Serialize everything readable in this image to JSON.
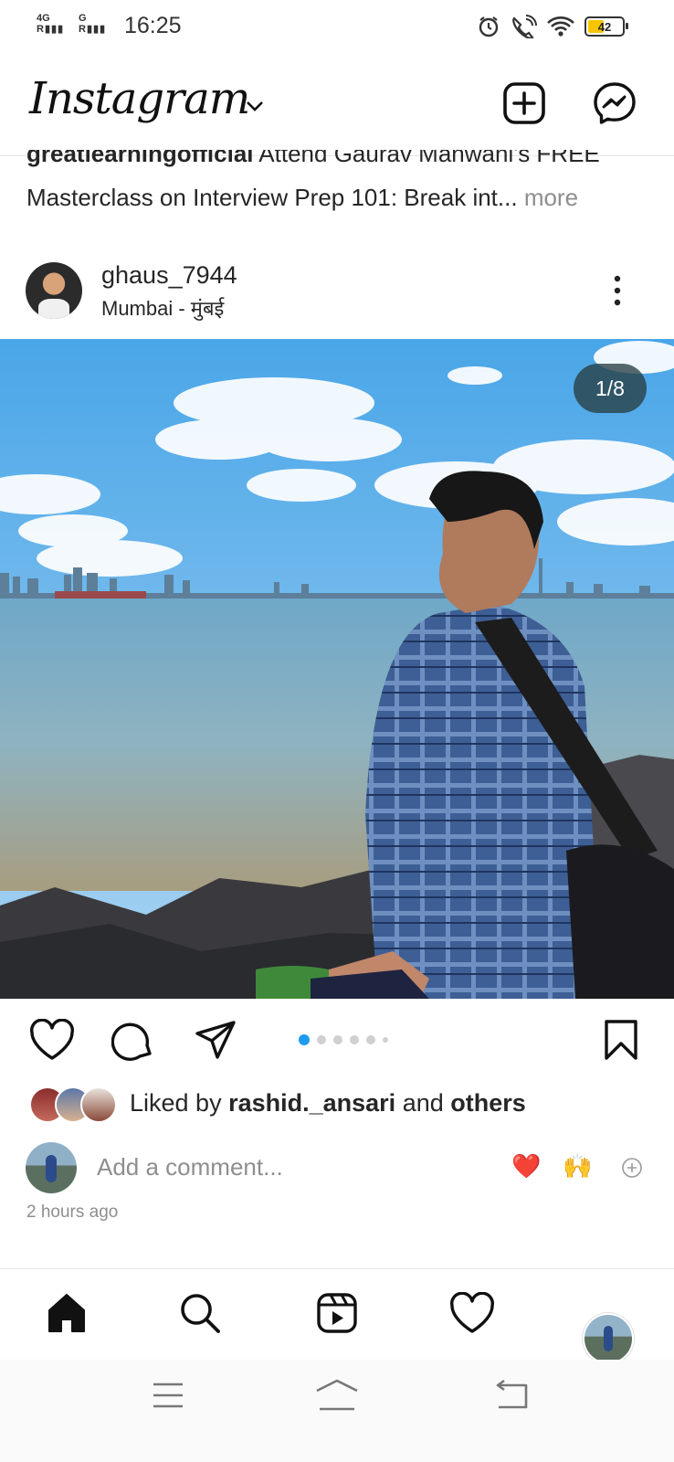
{
  "status_bar": {
    "network1": "4G",
    "network2": "G",
    "time": "16:25",
    "battery": "42",
    "icons": [
      "alarm-icon",
      "wifi-calling-icon",
      "wifi-icon",
      "battery-icon"
    ]
  },
  "header": {
    "logo": "Instagram",
    "icons": [
      "chevron-down-icon",
      "new-post-icon",
      "messenger-icon"
    ]
  },
  "caption": {
    "username": "greatlearningofficial",
    "text_line1": "Attend Gaurav Manwani's FREE",
    "text_line2": "Masterclass on Interview Prep 101: Break int...",
    "more": "more"
  },
  "post": {
    "username": "ghaus_7944",
    "location": "Mumbai - मुंबई",
    "image_counter": "1/8",
    "carousel": {
      "total_dots": 6,
      "active_index": 0
    },
    "likes": {
      "prefix": "Liked by",
      "user": "rashid._ansari",
      "conjunction": "and",
      "others": "others"
    },
    "comment_placeholder": "Add a comment...",
    "quick_reactions": [
      "❤️",
      "🙌"
    ],
    "time_ago": "2 hours ago"
  },
  "bottom_nav": {
    "items": [
      "home-icon",
      "search-icon",
      "reels-icon",
      "activity-heart-icon",
      "profile-avatar"
    ]
  },
  "colors": {
    "accent": "#1d9bf0",
    "text": "#262626",
    "muted": "#8e8e8e",
    "heart_red": "#e0212e"
  }
}
